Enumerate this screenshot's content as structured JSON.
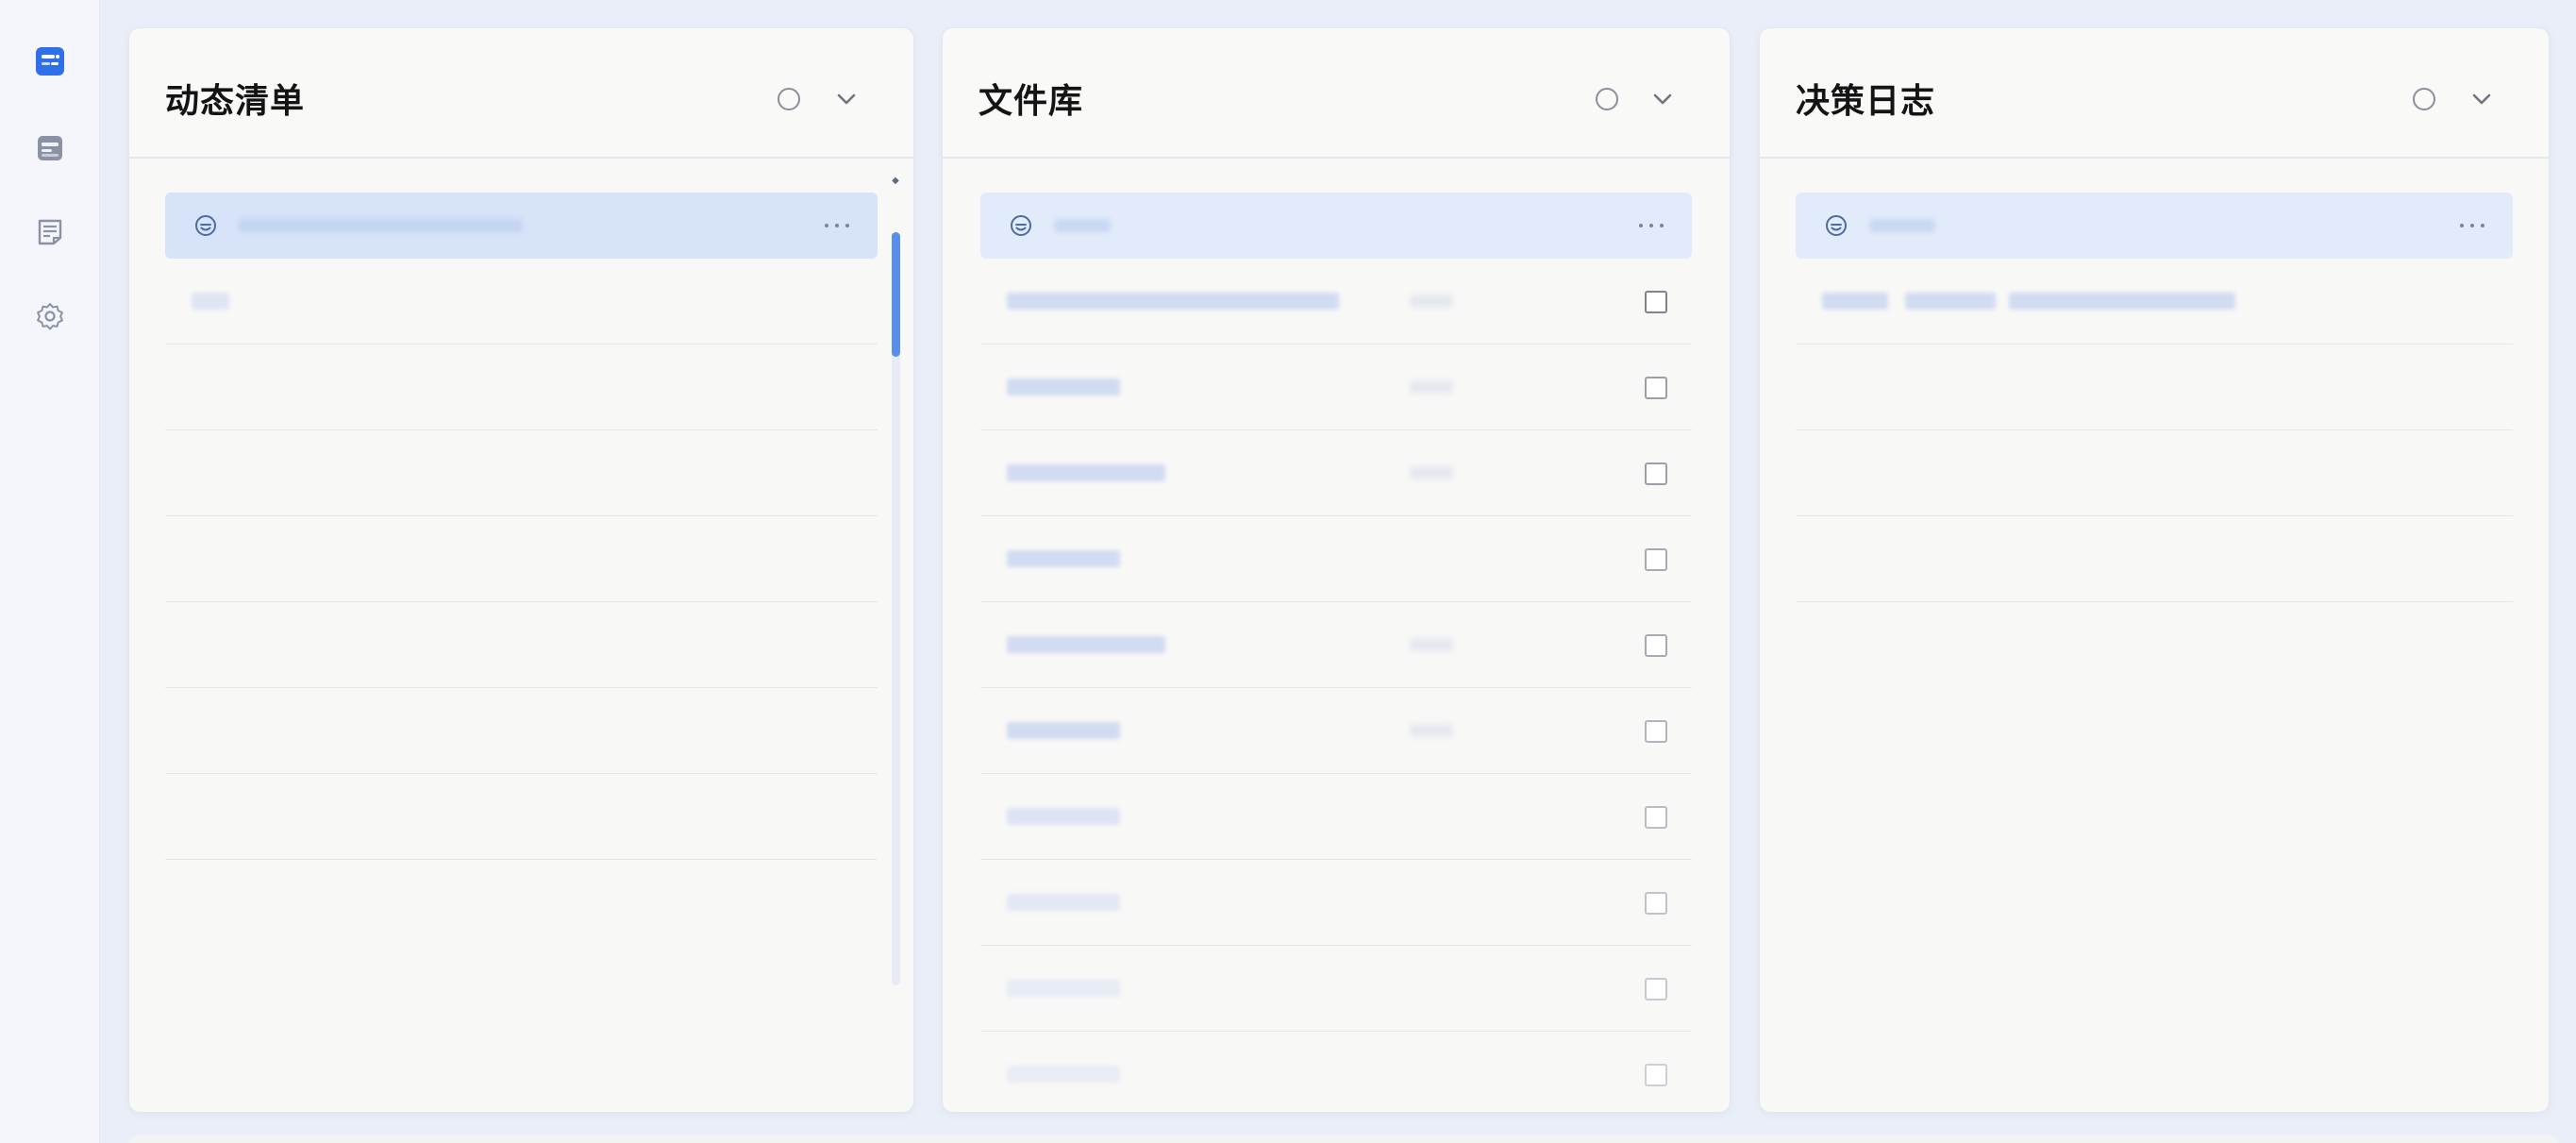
{
  "rail": {
    "items": [
      {
        "name": "dashboard",
        "icon": "dashboard-icon",
        "active": true
      },
      {
        "name": "messages",
        "icon": "message-icon",
        "active": false
      },
      {
        "name": "notes",
        "icon": "notes-icon",
        "active": false
      },
      {
        "name": "settings",
        "icon": "settings-icon",
        "active": false
      }
    ]
  },
  "panels": [
    {
      "title": "动态清单",
      "header_icons": [
        "circle-icon",
        "chevron-down-icon"
      ],
      "group_icon": "smile-icon",
      "rows_with_checkbox": false
    },
    {
      "title": "文件库",
      "header_icons": [
        "circle-icon",
        "chevron-down-icon"
      ],
      "group_icon": "smile-icon",
      "rows_with_checkbox": true
    },
    {
      "title": "决策日志",
      "header_icons": [
        "circle-icon",
        "chevron-down-icon"
      ],
      "group_icon": "smile-icon",
      "rows_with_checkbox": false
    }
  ],
  "colors": {
    "accent": "#2f6fe8",
    "scroll_thumb": "#5a8ee8",
    "selected_row": "#d6e3f8",
    "panel_bg": "#f8f8f6"
  }
}
